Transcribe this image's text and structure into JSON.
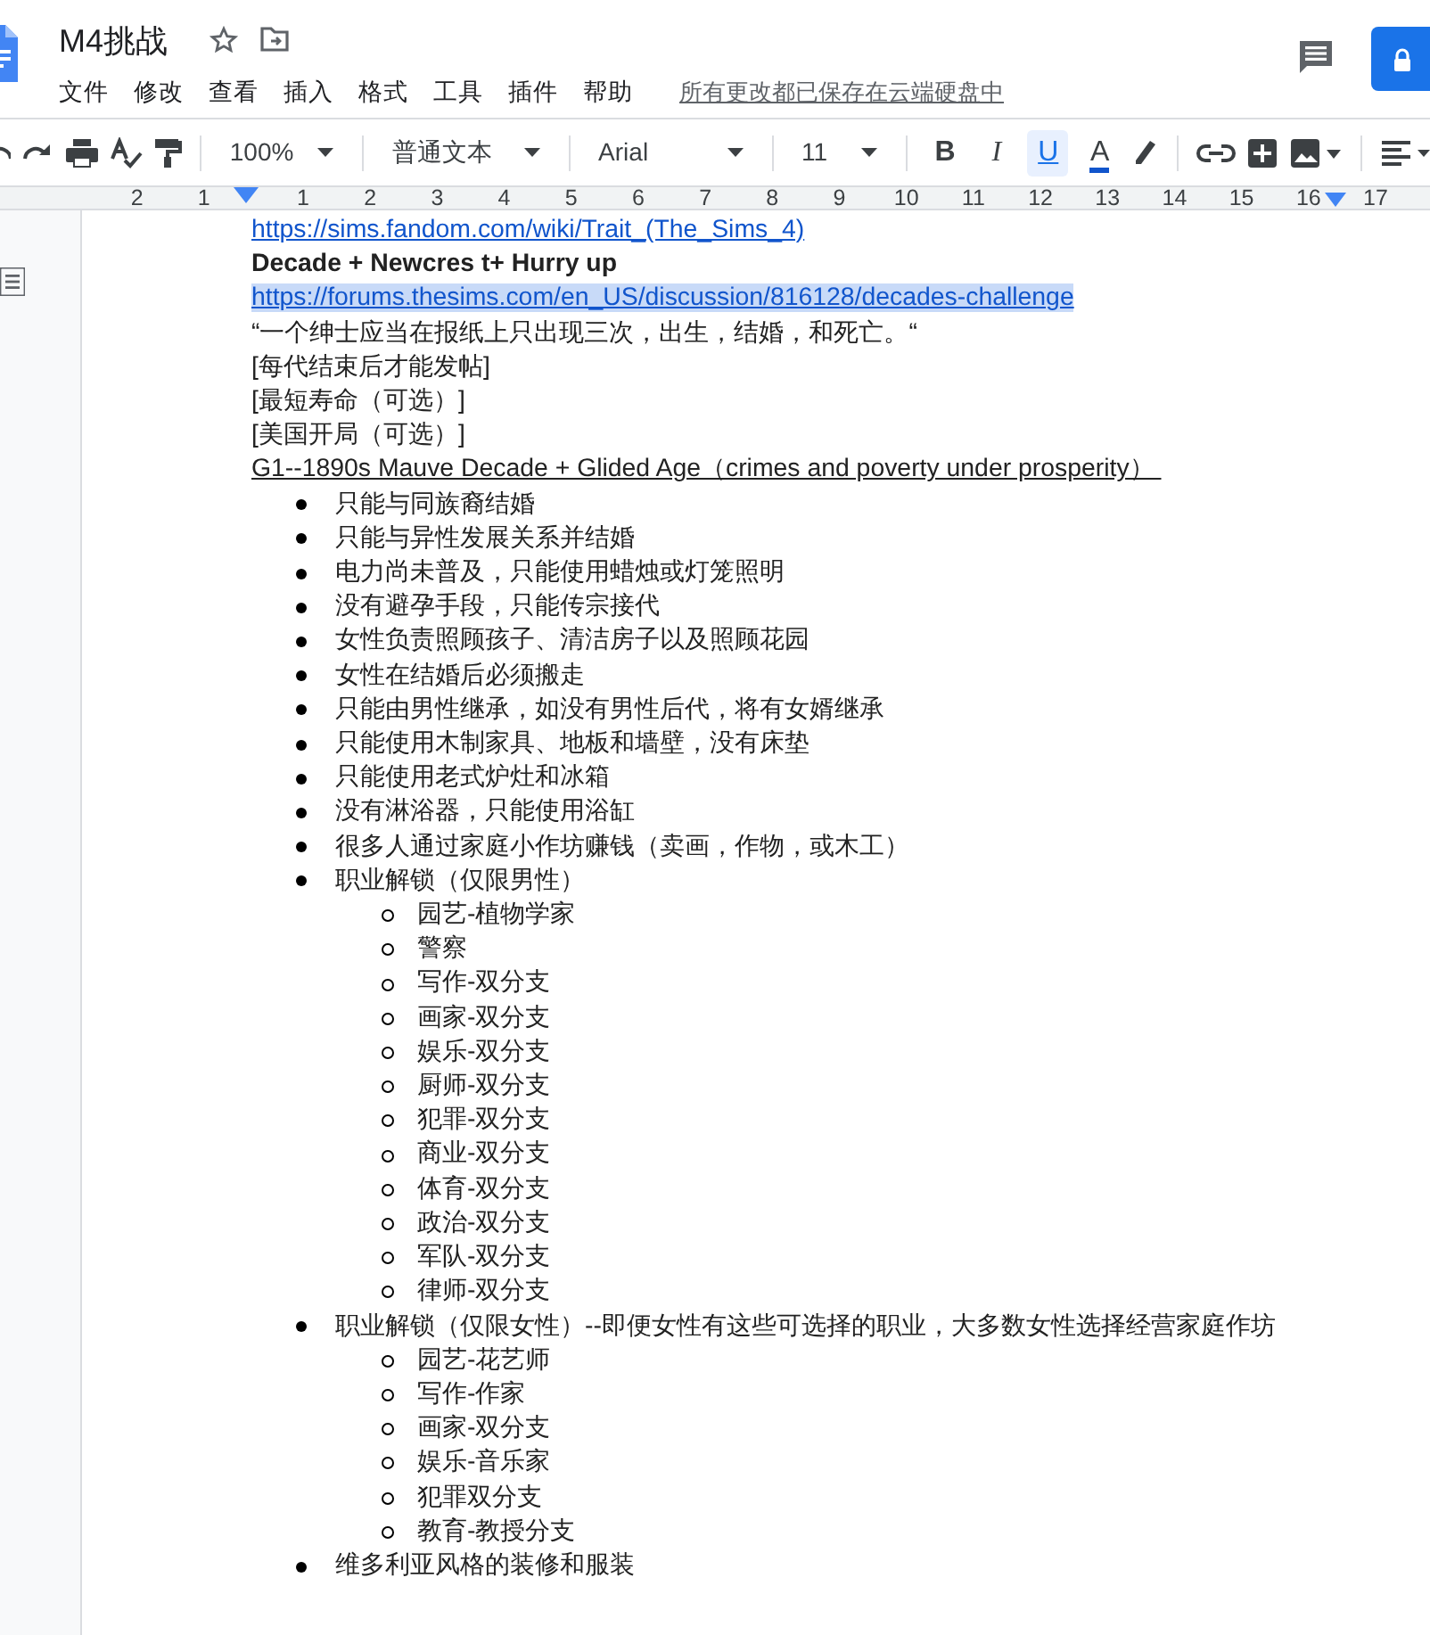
{
  "document_title": "M4挑战",
  "menus": [
    "文件",
    "修改",
    "查看",
    "插入",
    "格式",
    "工具",
    "插件",
    "帮助"
  ],
  "save_status": "所有更改都已保存在云端硬盘中",
  "toolbar": {
    "zoom": "100%",
    "style": "普通文本",
    "font": "Arial",
    "size": "11",
    "format_buttons": [
      {
        "kind": "bold",
        "label": "B",
        "selected": false
      },
      {
        "kind": "italic",
        "label": "I",
        "selected": false
      },
      {
        "kind": "underline",
        "label": "U",
        "selected": true
      },
      {
        "kind": "color",
        "label": "A",
        "selected": false
      }
    ]
  },
  "ruler": [
    "2",
    "1",
    "1",
    "2",
    "3",
    "4",
    "5",
    "6",
    "7",
    "8",
    "9",
    "10",
    "11",
    "12",
    "13",
    "14",
    "15",
    "16",
    "17"
  ],
  "lines": [
    {
      "kind": "link",
      "text": "https://sims.fandom.com/wiki/Trait_(The_Sims_4)",
      "selected": false
    },
    {
      "kind": "heading",
      "text": "Decade + Newcres t+ Hurry up"
    },
    {
      "kind": "link",
      "text": "https://forums.thesims.com/en_US/discussion/816128/decades-challenge",
      "selected": true
    },
    {
      "kind": "text",
      "text": "“一个绅士应当在报纸上只出现三次，出生，结婚，和死亡。“"
    },
    {
      "kind": "text",
      "text": "[每代结束后才能发帖]"
    },
    {
      "kind": "text",
      "text": "[最短寿命（可选）]"
    },
    {
      "kind": "text",
      "text": "[美国开局（可选）]"
    },
    {
      "kind": "underlined",
      "text": "G1--1890s Mauve Decade + Glided Age（crimes and poverty under prosperity） "
    },
    {
      "kind": "list",
      "items": [
        {
          "text": "只能与同族裔结婚"
        },
        {
          "text": "只能与异性发展关系并结婚"
        },
        {
          "text": "电力尚未普及，只能使用蜡烛或灯笼照明"
        },
        {
          "text": "没有避孕手段，只能传宗接代"
        },
        {
          "text": "女性负责照顾孩子、清洁房子以及照顾花园"
        },
        {
          "text": "女性在结婚后必须搬走"
        },
        {
          "text": "只能由男性继承，如没有男性后代，将有女婿继承"
        },
        {
          "text": "只能使用木制家具、地板和墙壁，没有床垫"
        },
        {
          "text": "只能使用老式炉灶和冰箱"
        },
        {
          "text": "没有淋浴器，只能使用浴缸"
        },
        {
          "text": "很多人通过家庭小作坊赚钱（卖画，作物，或木工）"
        },
        {
          "text": "职业解锁（仅限男性）",
          "children": [
            {
              "text": "园艺-植物学家"
            },
            {
              "text": "警察"
            },
            {
              "text": "写作-双分支"
            },
            {
              "text": "画家-双分支"
            },
            {
              "text": "娱乐-双分支"
            },
            {
              "text": "厨师-双分支"
            },
            {
              "text": "犯罪-双分支"
            },
            {
              "text": "商业-双分支"
            },
            {
              "text": "体育-双分支"
            },
            {
              "text": "政治-双分支"
            },
            {
              "text": "军队-双分支"
            },
            {
              "text": "律师-双分支"
            }
          ]
        },
        {
          "text": "职业解锁（仅限女性）--即便女性有这些可选择的职业，大多数女性选择经营家庭作坊",
          "children": [
            {
              "text": "园艺-花艺师"
            },
            {
              "text": "写作-作家"
            },
            {
              "text": "画家-双分支"
            },
            {
              "text": "娱乐-音乐家"
            },
            {
              "text": "犯罪双分支"
            },
            {
              "text": "教育-教授分支"
            }
          ]
        },
        {
          "text": "维多利亚风格的装修和服装"
        }
      ]
    }
  ]
}
